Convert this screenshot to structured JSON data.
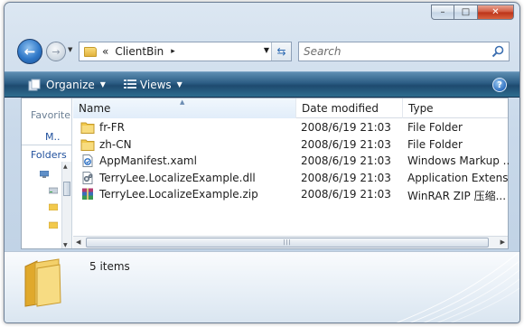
{
  "window": {
    "minimize_label": "–",
    "maximize_label": "□",
    "close_label": "✕"
  },
  "address": {
    "overflow": "«",
    "current_folder": "ClientBin",
    "crumb_arrow": "▸",
    "dropdown": "▼",
    "refresh": "⇆"
  },
  "search": {
    "placeholder": "Search"
  },
  "nav_buttons": {
    "back": "←",
    "forward": "→",
    "history": "▼"
  },
  "toolbar": {
    "organize_label": "Organize",
    "views_label": "Views",
    "caret": "▼",
    "help": "?"
  },
  "nav_pane": {
    "favorites_label": "Favorite l",
    "favorites_item": "M..",
    "folders_label": "Folders"
  },
  "columns": {
    "name": "Name",
    "date": "Date modified",
    "type": "Type",
    "sort_indicator": "▲"
  },
  "files": [
    {
      "name": "fr-FR",
      "date": "2008/6/19 21:03",
      "type": "File Folder",
      "icon": "folder-icon"
    },
    {
      "name": "zh-CN",
      "date": "2008/6/19 21:03",
      "type": "File Folder",
      "icon": "folder-icon"
    },
    {
      "name": "AppManifest.xaml",
      "date": "2008/6/19 21:03",
      "type": "Windows Markup ...",
      "icon": "xaml-file-icon"
    },
    {
      "name": "TerryLee.LocalizeExample.dll",
      "date": "2008/6/19 21:03",
      "type": "Application Extens...",
      "icon": "dll-file-icon"
    },
    {
      "name": "TerryLee.LocalizeExample.zip",
      "date": "2008/6/19 21:03",
      "type": "WinRAR ZIP 压缩...",
      "icon": "winrar-zip-icon"
    }
  ],
  "scroll": {
    "grip": "|||",
    "left": "◀",
    "right": "▶",
    "up": "▲",
    "down": "▼"
  },
  "details": {
    "item_count": "5 items"
  },
  "colors": {
    "toolbar_top": "#5d8db2",
    "toolbar_bottom": "#1e4a6f",
    "frame": "#c9d9ea",
    "folder_yellow": "#f2c94c"
  }
}
